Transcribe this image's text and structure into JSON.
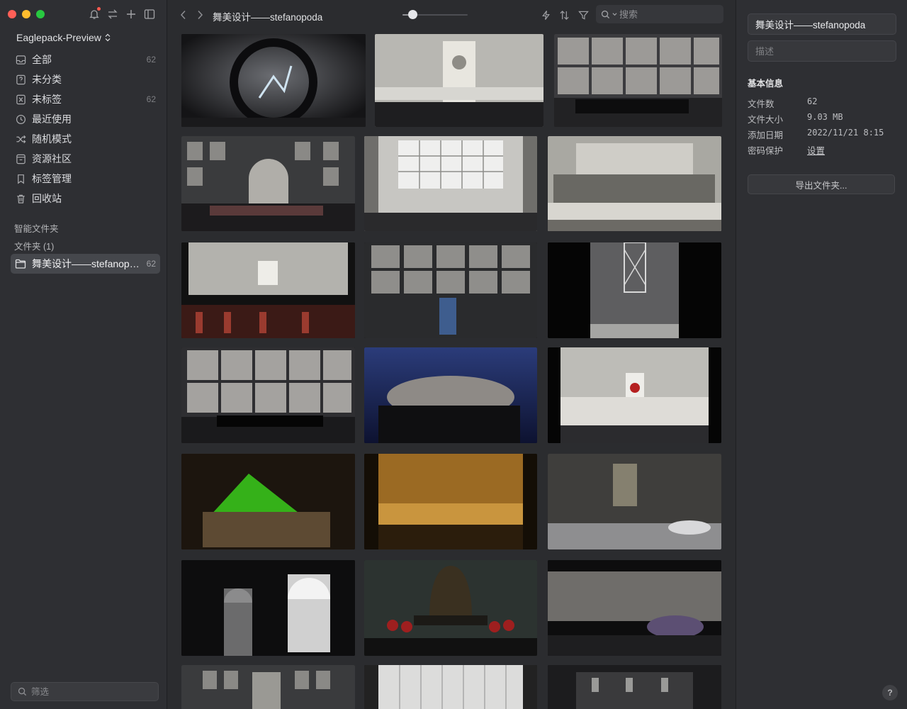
{
  "sidebar": {
    "library_name": "Eaglepack-Preview",
    "items": [
      {
        "label": "全部",
        "count": "62",
        "icon": "inbox-icon"
      },
      {
        "label": "未分类",
        "count": "",
        "icon": "question-box-icon"
      },
      {
        "label": "未标签",
        "count": "62",
        "icon": "untagged-icon"
      },
      {
        "label": "最近使用",
        "count": "",
        "icon": "clock-icon"
      },
      {
        "label": "随机模式",
        "count": "",
        "icon": "shuffle-icon"
      },
      {
        "label": "资源社区",
        "count": "",
        "icon": "community-icon"
      },
      {
        "label": "标签管理",
        "count": "",
        "icon": "bookmark-icon"
      },
      {
        "label": "回收站",
        "count": "",
        "icon": "trash-icon"
      }
    ],
    "smart_folders_label": "智能文件夹",
    "folders_label": "文件夹 (1)",
    "folder": {
      "label": "舞美设计——stefanopoda",
      "count": "62"
    },
    "filter_placeholder": "筛选"
  },
  "toolbar": {
    "breadcrumb": "舞美设计——stefanopoda",
    "zoom_level": 0.15,
    "search_placeholder": "搜索"
  },
  "panel": {
    "folder_name": "舞美设计——stefanopoda",
    "description_placeholder": "描述",
    "info_title": "基本信息",
    "rows": [
      {
        "key": "文件数",
        "value": "62"
      },
      {
        "key": "文件大小",
        "value": "9.03 MB"
      },
      {
        "key": "添加日期",
        "value": "2022/11/21 8:15"
      },
      {
        "key": "密码保护",
        "value": "设置"
      }
    ],
    "export_label": "导出文件夹...",
    "help_label": "?"
  },
  "colors": {
    "sidebar_bg": "#2e2f33",
    "main_bg": "#2b2c2f",
    "selected_folder": "#45474c",
    "close": "#ff5f57",
    "minimize": "#febc2e",
    "maximize": "#28c840"
  }
}
